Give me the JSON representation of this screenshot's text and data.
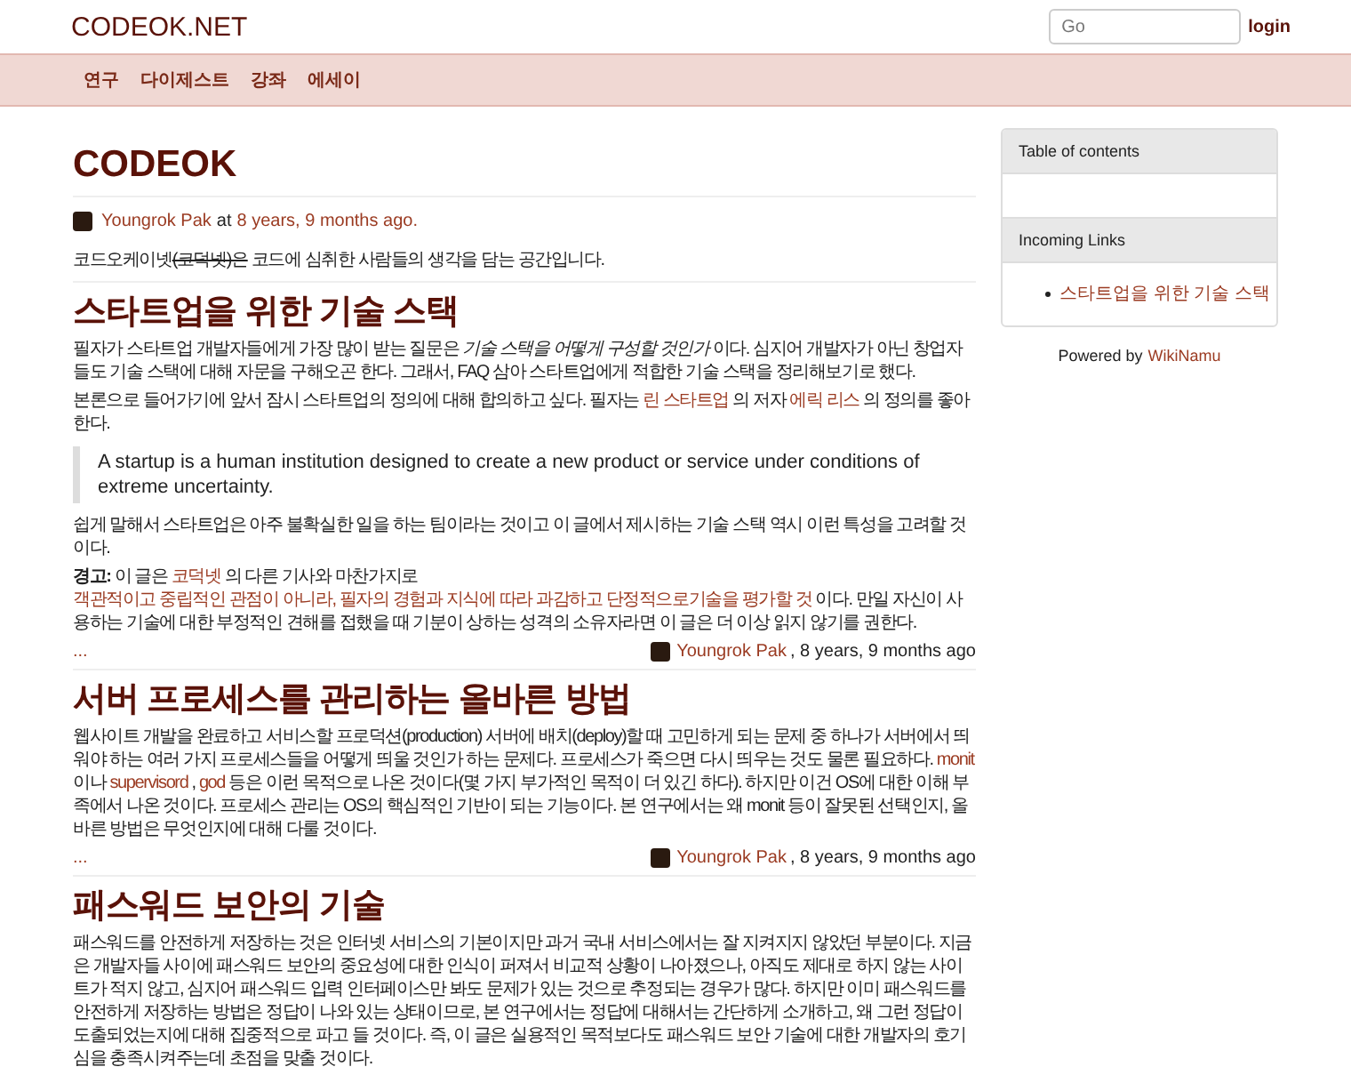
{
  "header": {
    "site_title": "CODEOK.NET",
    "search": {
      "placeholder": "Go"
    },
    "login": "login"
  },
  "nav": [
    "연구",
    "다이제스트",
    "강좌",
    "에세이"
  ],
  "page": {
    "title": "CODEOK",
    "meta": {
      "author": "Youngrok Pak",
      "connector": "at",
      "time": "8 years, 9 months ago."
    },
    "intro": [
      {
        "kind": "text",
        "text": "코드오케이넷"
      },
      {
        "kind": "strike",
        "text": "(코덕넷)은"
      },
      {
        "kind": "text",
        "text": " 코드에 심취한 사람들의 생각을 담는 공간입니다."
      }
    ]
  },
  "posts": [
    {
      "title": "스타트업을 위한 기술 스택",
      "blocks": [
        {
          "kind": "para",
          "segments": [
            {
              "kind": "text",
              "text": "필자가 스타트업 개발자들에게 가장 많이 받는 질문은 *기술 스택을 어떻게 구성할 것인가* 이다. 심지어 개발자가 아닌 창업자들도 기술 스택에 대해 자문을 구해오곤 한다. 그래서, FAQ 삼아 스타트업에게 적합한 기술 스택을 정리해보기로 했다."
            }
          ]
        },
        {
          "kind": "para",
          "segments": [
            {
              "kind": "text",
              "text": "본론으로 들어가기에 앞서 잠시 스타트업의 정의에 대해 합의하고 싶다. 필자는 "
            },
            {
              "kind": "link",
              "text": "린 스타트업"
            },
            {
              "kind": "text",
              "text": " 의 저자 "
            },
            {
              "kind": "link",
              "text": "에릭 리스"
            },
            {
              "kind": "text",
              "text": " 의 정의를 좋아한다."
            }
          ]
        },
        {
          "kind": "quote",
          "text": "A startup is a human institution designed to create a new product or service under conditions of extreme uncertainty."
        },
        {
          "kind": "para",
          "segments": [
            {
              "kind": "text",
              "text": "쉽게 말해서 스타트업은 아주 불확실한 일을 하는 팀이라는 것이고 이 글에서 제시하는 기술 스택 역시 이런 특성을 고려할 것이다."
            }
          ]
        },
        {
          "kind": "para",
          "segments": [
            {
              "kind": "text",
              "text": "**경고:** 이 글은 "
            },
            {
              "kind": "link",
              "text": "코덕넷"
            },
            {
              "kind": "text",
              "text": " 의 다른 기사와 마찬가지로 "
            },
            {
              "kind": "link",
              "text": "객관적이고 중립적인 관점이 아니라, 필자의 경험과 지식에 따라 과감하고 단정적으로"
            },
            {
              "kind": "link",
              "text": "기술을 평가할 것"
            },
            {
              "kind": "text",
              "text": " 이다. 만일 자신이 사용하는 기술에 대한 부정적인 견해를 접했을 때 기분이 상하는 성격의 소유자라면 이 글은 더 이상 읽지 않기를 권한다."
            }
          ]
        }
      ],
      "footer": {
        "more": "...",
        "author": "Youngrok Pak",
        "time": ", 8 years, 9 months ago"
      }
    },
    {
      "title": "서버 프로세스를 관리하는 올바른 방법",
      "blocks": [
        {
          "kind": "para",
          "segments": [
            {
              "kind": "text",
              "text": "웹사이트 개발을 완료하고 서비스할 프로덕션(production) 서버에 배치(deploy)할 때 고민하게 되는 문제 중 하나가 서버에서 띄워야 하는 여러 가지 프로세스들을 어떻게 띄울 것인가 하는 문제다. 프로세스가 죽으면 다시 띄우는 것도 물론 필요하다. "
            },
            {
              "kind": "link",
              "text": "monit"
            },
            {
              "kind": "text",
              "text": " 이나 "
            },
            {
              "kind": "link",
              "text": "supervisord"
            },
            {
              "kind": "text",
              "text": " , "
            },
            {
              "kind": "link",
              "text": "god"
            },
            {
              "kind": "text",
              "text": " 등은 이런 목적으로 나온 것이다(몇 가지 부가적인 목적이 더 있긴 하다). 하지만 이건 OS에 대한 이해 부족에서 나온 것이다. 프로세스 관리는 OS의 핵심적인 기반이 되는 기능이다. 본 연구에서는 왜 monit 등이 잘못된 선택인지, 올바른 방법은 무엇인지에 대해 다룰 것이다."
            }
          ]
        }
      ],
      "footer": {
        "more": "...",
        "author": "Youngrok Pak",
        "time": ", 8 years, 9 months ago"
      }
    },
    {
      "title": "패스워드 보안의 기술",
      "blocks": [
        {
          "kind": "para",
          "segments": [
            {
              "kind": "text",
              "text": "패스워드를 안전하게 저장하는 것은 인터넷 서비스의 기본이지만 과거 국내 서비스에서는 잘 지켜지지 않았던 부분이다. 지금은 개발자들 사이에 패스워드 보안의 중요성에 대한 인식이 퍼져서 비교적 상황이 나아졌으나, 아직도 제대로 하지 않는 사이트가 적지 않고, 심지어 패스워드 입력 인터페이스만 봐도 문제가 있는 것으로 추정되는 경우가 많다. 하지만 이미 패스워드를 안전하게 저장하는 방법은 정답이 나와 있는 상태이므로, 본 연구에서는 정답에 대해서는 간단하게 소개하고, 왜 그런 정답이 도출되었는지에 대해 집중적으로 파고 들 것이다. 즉, 이 글은 실용적인 목적보다도 패스워드 보안 기술에 대한 개발자의 호기심을 충족시켜주는데 초점을 맞출 것이다."
            }
          ]
        }
      ]
    }
  ],
  "sidebar": {
    "toc_title": "Table of contents",
    "incoming_title": "Incoming Links",
    "incoming": [
      "스타트업을 위한 기술 스택"
    ],
    "powered_by": "Powered by",
    "powered_link": "WikiNamu"
  }
}
